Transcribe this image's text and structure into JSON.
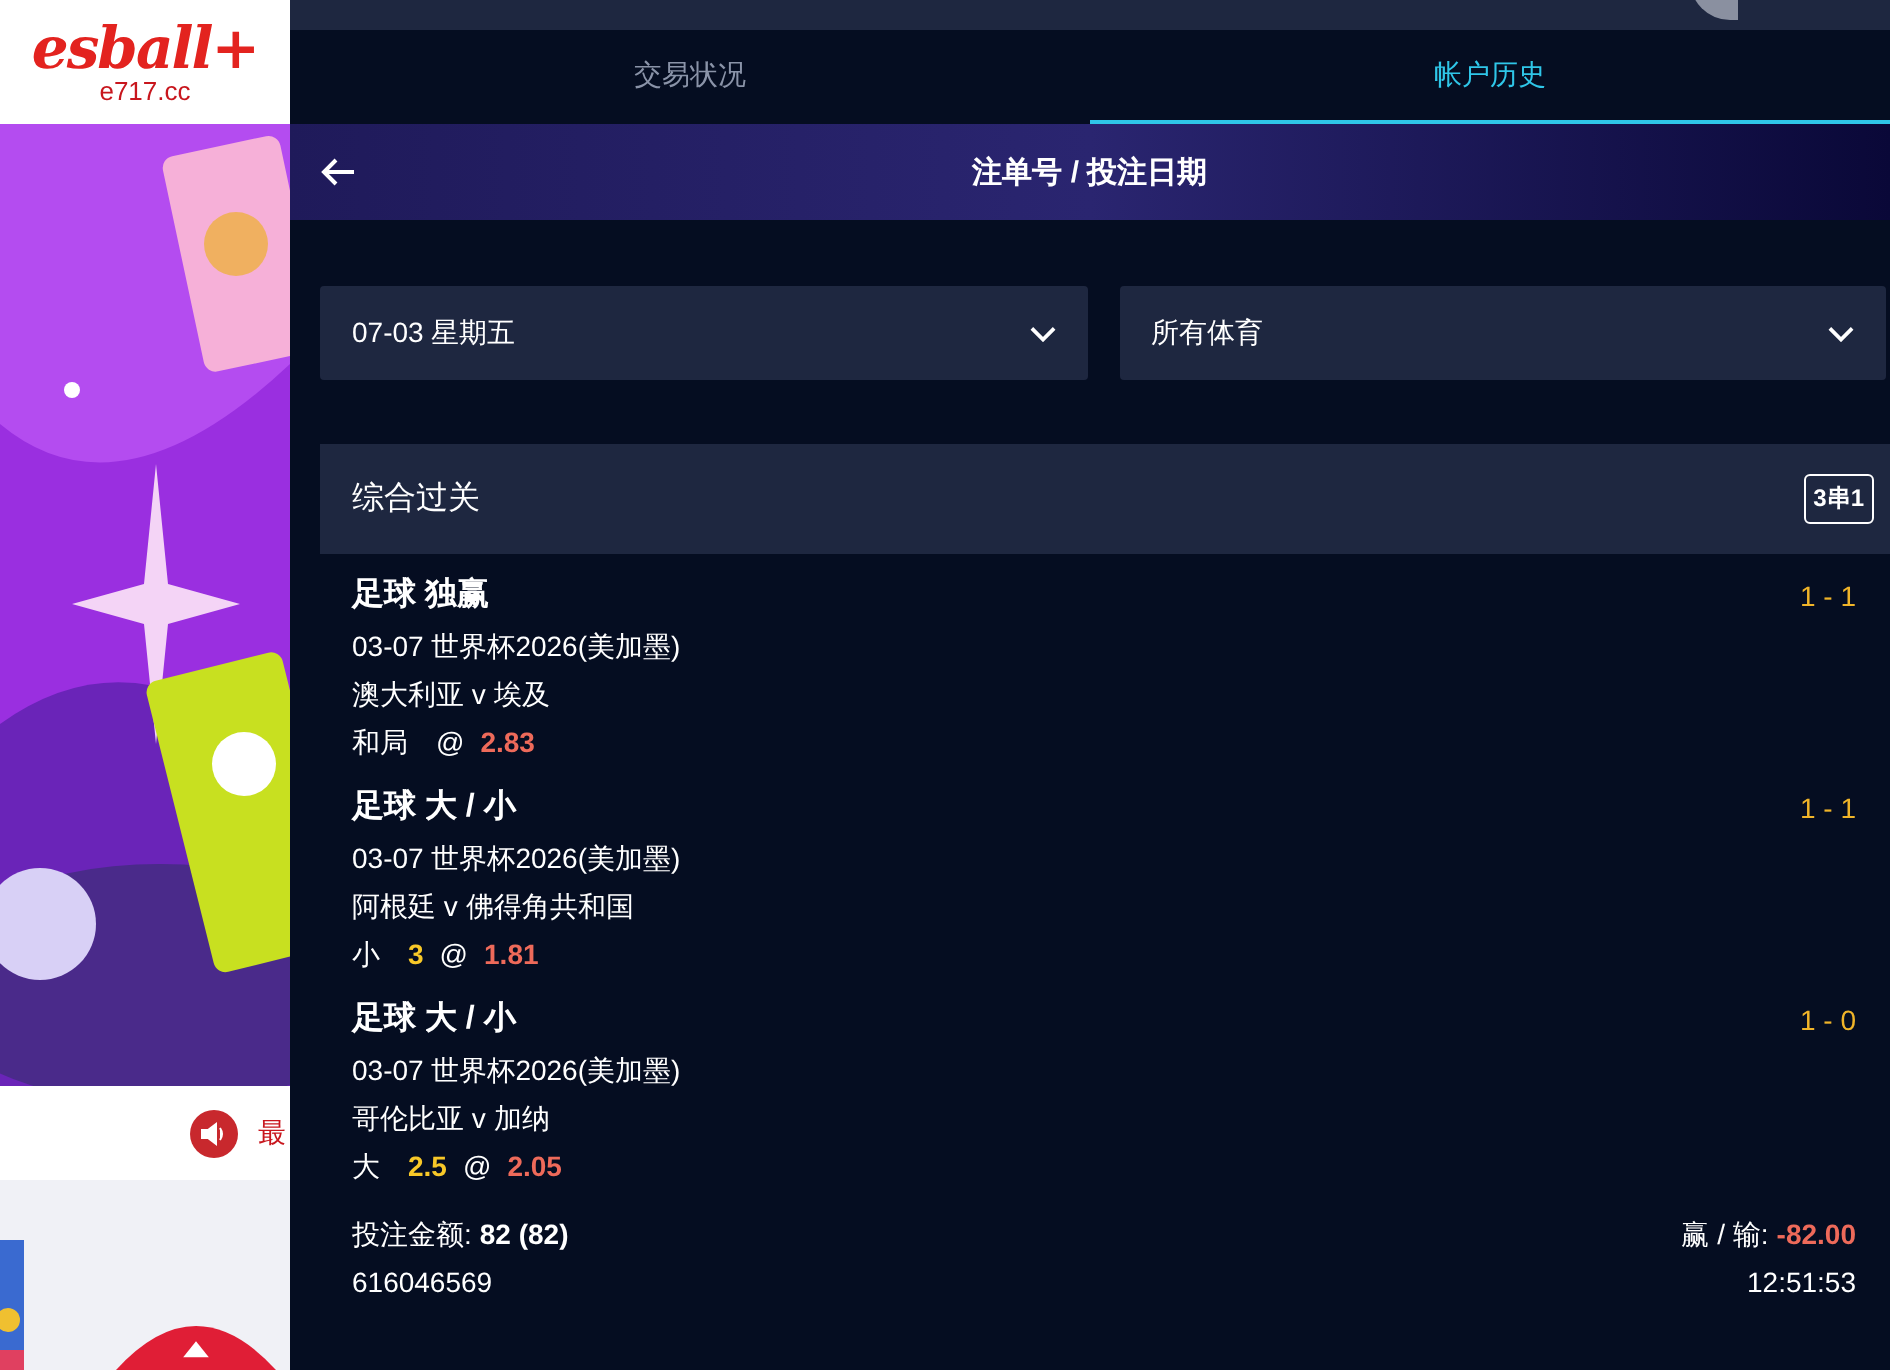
{
  "site": {
    "logo": "esball+",
    "domain": "e717.cc",
    "announcement": "最"
  },
  "tabs": [
    {
      "label": "交易状况",
      "selected": false
    },
    {
      "label": "帐户历史",
      "selected": true
    }
  ],
  "header": {
    "title": "注单号 / 投注日期"
  },
  "filters": [
    {
      "value": "07-03 星期五"
    },
    {
      "value": "所有体育"
    }
  ],
  "bet": {
    "type": "综合过关",
    "badge": "3串1",
    "legs": [
      {
        "title": "足球 独赢",
        "score": "1 - 1",
        "league": "03-07 世界杯2026(美加墨)",
        "match": "澳大利亚 v 埃及",
        "pick": "和局",
        "at": "@",
        "odds": "2.83"
      },
      {
        "title": "足球 大 / 小",
        "score": "1 - 1",
        "league": "03-07 世界杯2026(美加墨)",
        "match": "阿根廷 v 佛得角共和国",
        "pick": "小",
        "line": "3",
        "at": "@",
        "odds": "1.81"
      },
      {
        "title": "足球 大 / 小",
        "score": "1 - 0",
        "league": "03-07 世界杯2026(美加墨)",
        "match": "哥伦比亚 v 加纳",
        "pick": "大",
        "line": "2.5",
        "at": "@",
        "odds": "2.05"
      }
    ],
    "stake_label": "投注金额:",
    "stake": "82 (82)",
    "winloss_label": "赢 / 输:",
    "winloss": "-82.00",
    "id": "616046569",
    "time": "12:51:53"
  }
}
